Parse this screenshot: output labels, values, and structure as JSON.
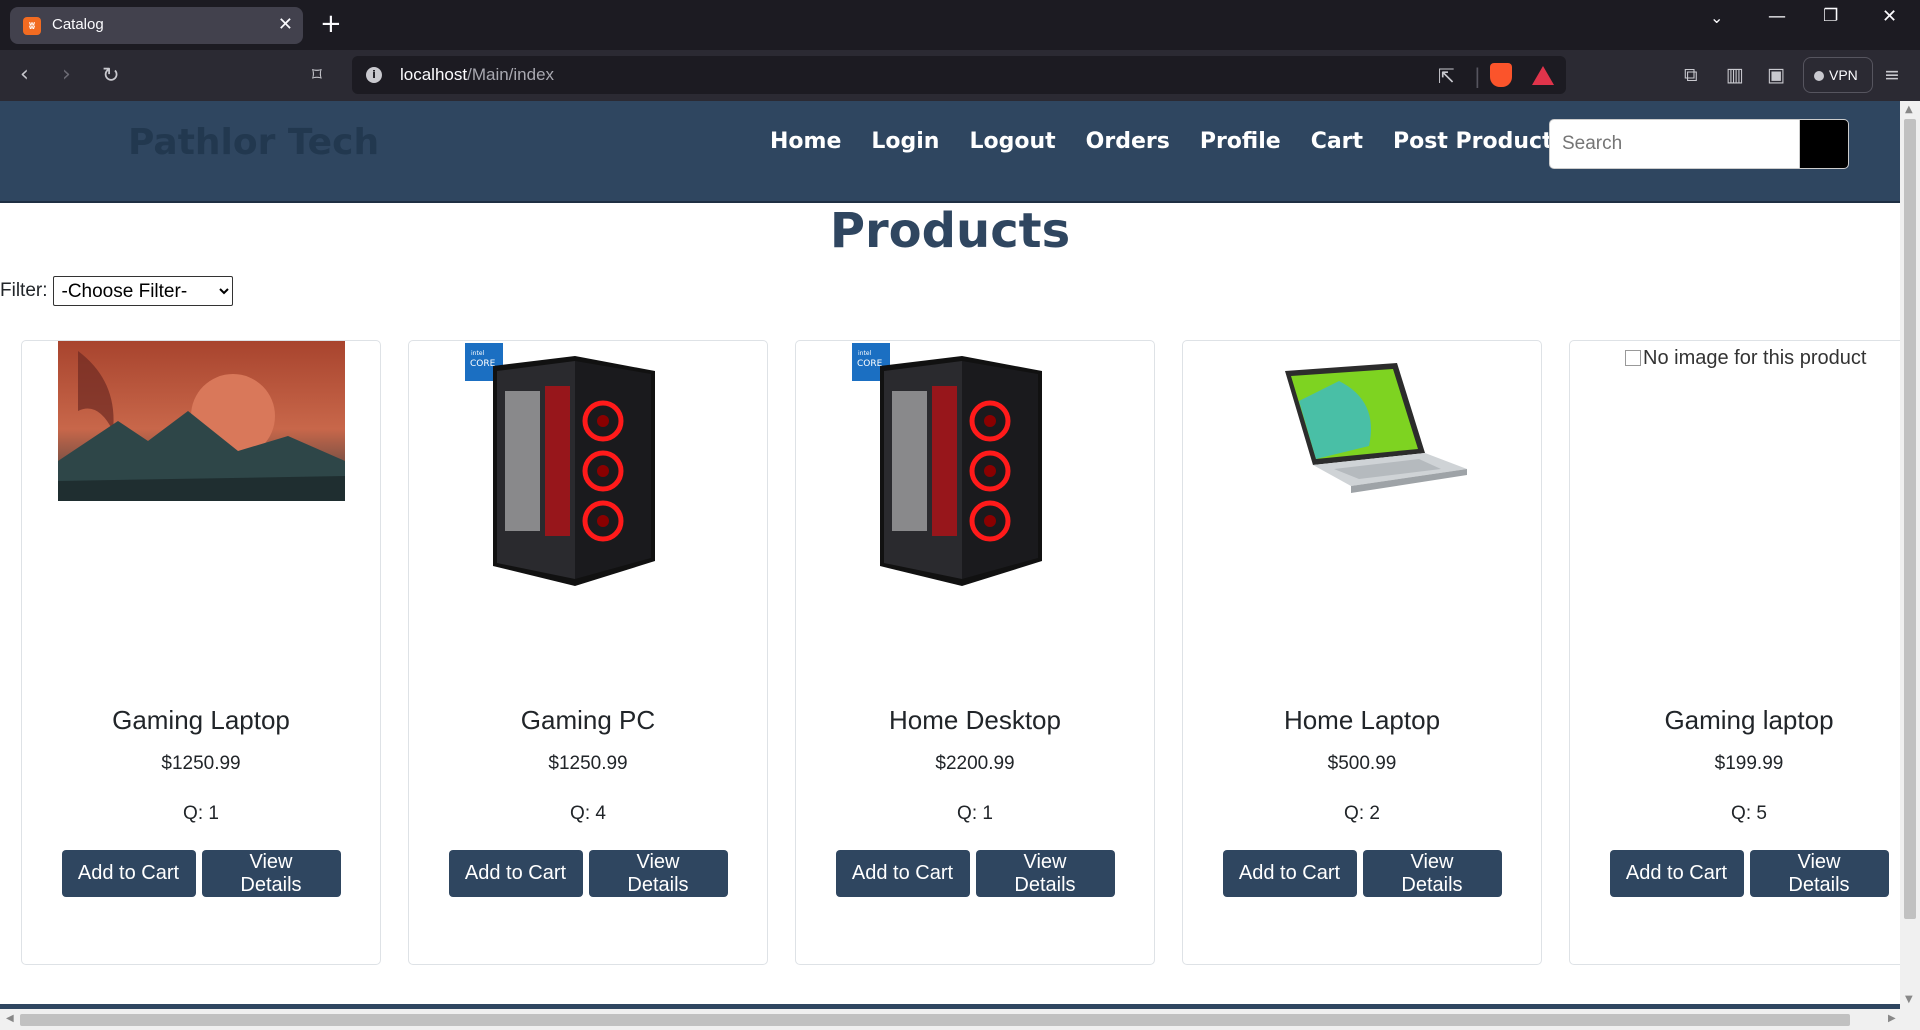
{
  "browser": {
    "tab_title": "Catalog",
    "new_tab": "+",
    "url_host": "localhost",
    "url_path": "/Main/index",
    "vpn_label": "VPN"
  },
  "site": {
    "brand": "Pathlor Tech",
    "menu": [
      {
        "label": "Home"
      },
      {
        "label": "Login"
      },
      {
        "label": "Logout"
      },
      {
        "label": "Orders"
      },
      {
        "label": "Profile"
      },
      {
        "label": "Cart"
      },
      {
        "label": "Post Product"
      }
    ],
    "search_placeholder": "Search"
  },
  "page": {
    "title": "Products",
    "filter_label": "Filter:",
    "filter_selected": "-Choose Filter-"
  },
  "products": [
    {
      "name": "Gaming Laptop",
      "price": "$1250.99",
      "qty": "Q: 1",
      "image": "volcano-planet-artwork"
    },
    {
      "name": "Gaming PC",
      "price": "$1250.99",
      "qty": "Q: 4",
      "image": "gaming-pc-tower"
    },
    {
      "name": "Home Desktop",
      "price": "$2200.99",
      "qty": "Q: 1",
      "image": "gaming-pc-tower"
    },
    {
      "name": "Home Laptop",
      "price": "$500.99",
      "qty": "Q: 2",
      "image": "silver-laptop"
    },
    {
      "name": "Gaming laptop",
      "price": "$199.99",
      "qty": "Q: 5",
      "image": "none",
      "alt_text": "No image for this product"
    }
  ],
  "buttons": {
    "add_to_cart": "Add to Cart",
    "view_details": "View Details"
  },
  "colors": {
    "header_bg": "#2f4660",
    "brand_text": "#22384f",
    "button_bg": "#2f4660"
  }
}
